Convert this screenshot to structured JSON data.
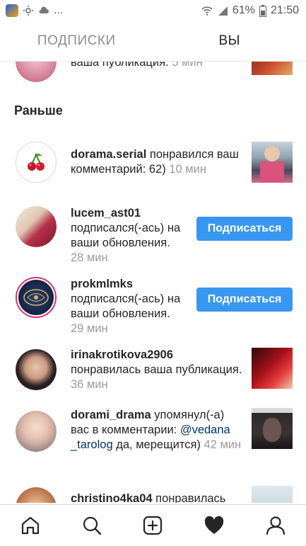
{
  "status_bar": {
    "left_icons": [
      "app-icon",
      "weather-icon",
      "cloud-icon"
    ],
    "ellipsis": "...",
    "battery": "61%",
    "time": "21:50"
  },
  "tabs": [
    {
      "label": "ПОДПИСКИ",
      "active": false
    },
    {
      "label": "ВЫ",
      "active": true
    }
  ],
  "top_partial": {
    "text": "ваша публикация.",
    "time": "5 мин"
  },
  "section_title": "Раньше",
  "notifications": [
    {
      "user": "dorama.serial",
      "action": " понравился ваш комментарий: 62)",
      "time": " 10 мин",
      "avatar": "cherry-icon"
    },
    {
      "user": "lucem_ast01",
      "action": "подписался(-ась) на ваши обновления.",
      "time": "28 мин",
      "button": "Подписаться"
    },
    {
      "user": "prokmlmks",
      "action": "подписался(-ась) на ваши обновления.",
      "time": "29 мин",
      "button": "Подписаться"
    },
    {
      "user": "irinakrotikova2906",
      "action": "понравилась ваша публикация.",
      "time": " 36 мин"
    },
    {
      "user": "dorami_drama",
      "action_pre": " упомянул(-а) вас в комментарии: ",
      "mention": "@vedana _tarolog",
      "action_post": " да, мерещится)",
      "time": " 42 мин"
    },
    {
      "user": "christino4ka04",
      "action": " понравилась"
    }
  ],
  "bottom_nav": [
    "home-icon",
    "search-icon",
    "add-post-icon",
    "activity-heart-icon",
    "profile-icon"
  ],
  "colors": {
    "accent": "#3897f0",
    "text": "#262626",
    "muted": "#9a9a9a",
    "mention": "#003569"
  }
}
